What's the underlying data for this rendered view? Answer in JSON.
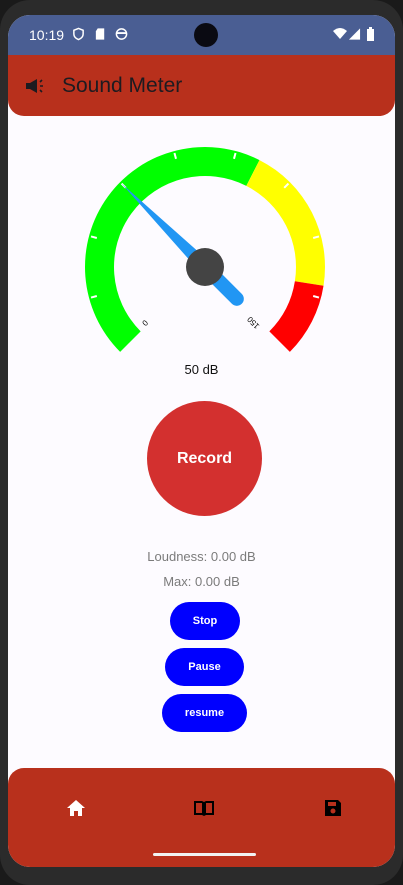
{
  "status_bar": {
    "time": "10:19",
    "icons": [
      "shield-icon",
      "sd-card-icon",
      "face-icon",
      "wifi-icon",
      "signal-icon",
      "battery-icon"
    ]
  },
  "app_bar": {
    "title": "Sound Meter",
    "icon": "megaphone-icon"
  },
  "gauge": {
    "min": 0,
    "max": 150,
    "value": 50,
    "min_label": "0",
    "max_label": "150",
    "value_label": "50 dB",
    "ranges": [
      {
        "from": 0,
        "to": 90,
        "color": "#00ff00"
      },
      {
        "from": 90,
        "to": 130,
        "color": "#ffff00"
      },
      {
        "from": 130,
        "to": 150,
        "color": "#ff0000"
      }
    ],
    "needle_color": "#2196f3",
    "hub_color": "#444444"
  },
  "record_label": "Record",
  "loudness": "Loudness: 0.00 dB",
  "max": "Max: 0.00 dB",
  "buttons": {
    "stop": "Stop",
    "pause": "Pause",
    "resume": "resume"
  },
  "bottom_nav": [
    {
      "icon": "home-icon",
      "active": true
    },
    {
      "icon": "book-icon",
      "active": false
    },
    {
      "icon": "save-icon",
      "active": false
    }
  ],
  "colors": {
    "primary": "#b8301c",
    "status": "#4a5e93",
    "button": "#0000ff",
    "record": "#d3302f"
  }
}
